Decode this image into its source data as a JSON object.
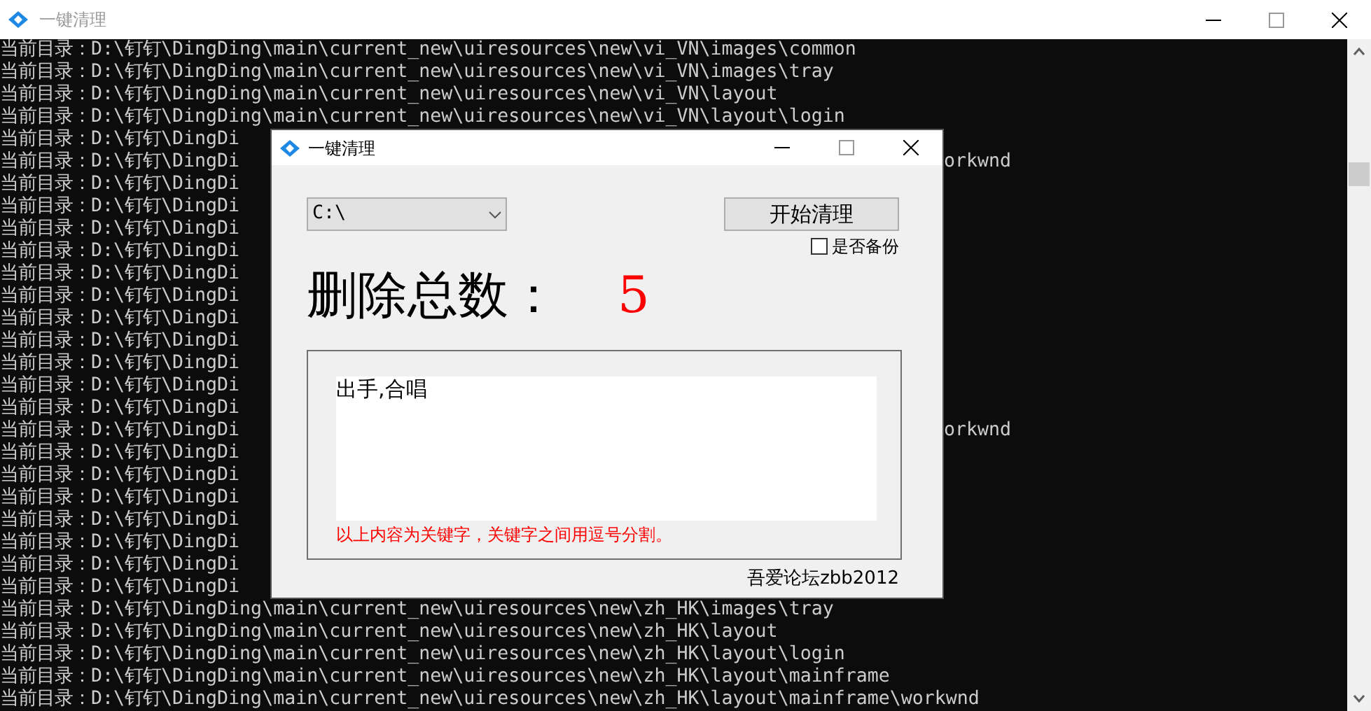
{
  "window": {
    "title": "一键清理"
  },
  "console": {
    "lines": [
      {
        "text": "当前目录：D:\\钉钉\\DingDing\\main\\current_new\\uiresources\\new\\vi_VN\\images\\common"
      },
      {
        "text": "当前目录：D:\\钉钉\\DingDing\\main\\current_new\\uiresources\\new\\vi_VN\\images\\tray"
      },
      {
        "text": "当前目录：D:\\钉钉\\DingDing\\main\\current_new\\uiresources\\new\\vi_VN\\layout"
      },
      {
        "text": "当前目录：D:\\钉钉\\DingDing\\main\\current_new\\uiresources\\new\\vi_VN\\layout\\login"
      },
      {
        "text": "当前目录：D:\\钉钉\\DingDi"
      },
      {
        "text": "当前目录：D:\\钉钉\\DingDi",
        "tail": "orkwnd"
      },
      {
        "text": "当前目录：D:\\钉钉\\DingDi"
      },
      {
        "text": "当前目录：D:\\钉钉\\DingDi"
      },
      {
        "text": "当前目录：D:\\钉钉\\DingDi"
      },
      {
        "text": "当前目录：D:\\钉钉\\DingDi"
      },
      {
        "text": "当前目录：D:\\钉钉\\DingDi"
      },
      {
        "text": "当前目录：D:\\钉钉\\DingDi"
      },
      {
        "text": "当前目录：D:\\钉钉\\DingDi"
      },
      {
        "text": "当前目录：D:\\钉钉\\DingDi"
      },
      {
        "text": "当前目录：D:\\钉钉\\DingDi"
      },
      {
        "text": "当前目录：D:\\钉钉\\DingDi"
      },
      {
        "text": "当前目录：D:\\钉钉\\DingDi"
      },
      {
        "text": "当前目录：D:\\钉钉\\DingDi",
        "tail": "orkwnd"
      },
      {
        "text": "当前目录：D:\\钉钉\\DingDi"
      },
      {
        "text": "当前目录：D:\\钉钉\\DingDi"
      },
      {
        "text": "当前目录：D:\\钉钉\\DingDi"
      },
      {
        "text": "当前目录：D:\\钉钉\\DingDi"
      },
      {
        "text": "当前目录：D:\\钉钉\\DingDi"
      },
      {
        "text": "当前目录：D:\\钉钉\\DingDi"
      },
      {
        "text": "当前目录：D:\\钉钉\\DingDi"
      },
      {
        "text": "当前目录：D:\\钉钉\\DingDing\\main\\current_new\\uiresources\\new\\zh_HK\\images\\tray"
      },
      {
        "text": "当前目录：D:\\钉钉\\DingDing\\main\\current_new\\uiresources\\new\\zh_HK\\layout"
      },
      {
        "text": "当前目录：D:\\钉钉\\DingDing\\main\\current_new\\uiresources\\new\\zh_HK\\layout\\login"
      },
      {
        "text": "当前目录：D:\\钉钉\\DingDing\\main\\current_new\\uiresources\\new\\zh_HK\\layout\\mainframe"
      },
      {
        "text": "当前目录：D:\\钉钉\\DingDing\\main\\current_new\\uiresources\\new\\zh_HK\\layout\\mainframe\\workwnd"
      }
    ]
  },
  "dialog": {
    "title": "一键清理",
    "drive": {
      "value": "C:\\"
    },
    "start_button": "开始清理",
    "backup": {
      "label": "是否备份",
      "checked": false
    },
    "total_label": "删除总数：",
    "total_value": "5",
    "keywords": {
      "value": "出手,合唱"
    },
    "hint": "以上内容为关键字，关键字之间用逗号分割。",
    "credit": "吾爱论坛zbb2012"
  }
}
